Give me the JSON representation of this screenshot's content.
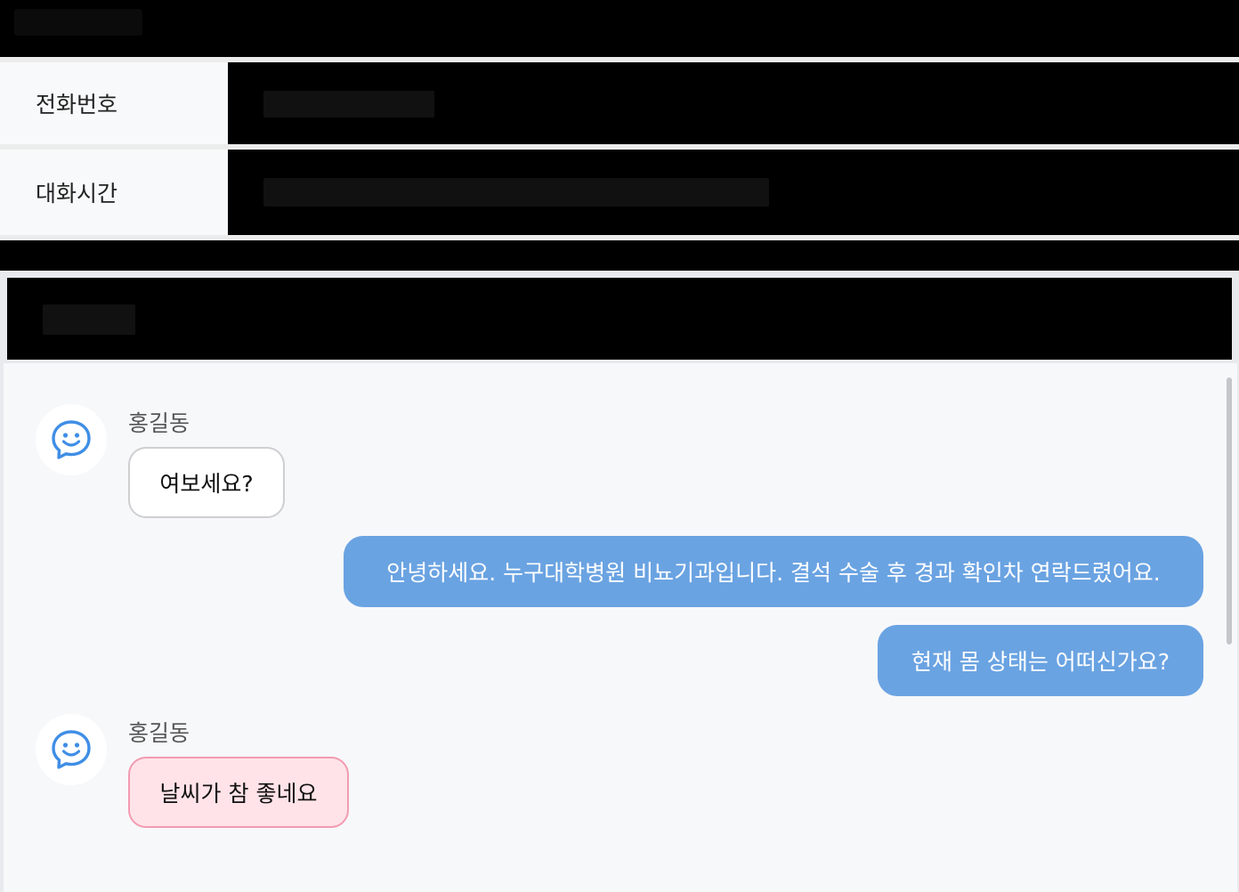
{
  "info": {
    "phone_label": "전화번호",
    "time_label": "대화시간"
  },
  "chat": {
    "messages": [
      {
        "sender": "홍길동",
        "text": "여보세요?",
        "direction": "incoming"
      },
      {
        "text": "안녕하세요. 누구대학병원 비뇨기과입니다. 결석 수술 후 경과 확인차 연락드렸어요.",
        "direction": "outgoing"
      },
      {
        "text": "현재 몸 상태는 어떠신가요?",
        "direction": "outgoing"
      },
      {
        "sender": "홍길동",
        "text": "날씨가 참 좋네요",
        "direction": "incoming",
        "highlight": true
      }
    ]
  },
  "colors": {
    "outgoing_bubble": "#6aa3e2",
    "incoming_highlight_bubble": "#ffe3e8",
    "avatar_icon": "#3f8ee6"
  },
  "icons": {
    "avatar": "smile-chat-bubble-icon"
  }
}
